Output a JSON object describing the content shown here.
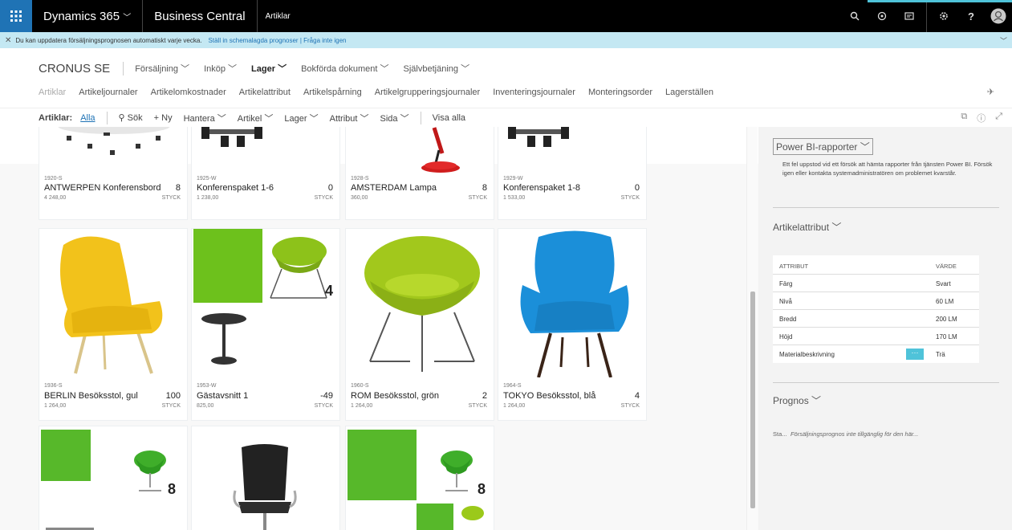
{
  "topbar": {
    "app": "Dynamics 365",
    "product": "Business Central",
    "page": "Artiklar",
    "icons": [
      "search-icon",
      "lightbulb-icon",
      "notes-icon",
      "gear-icon",
      "help-icon",
      "user-avatar"
    ]
  },
  "notification": {
    "text": "Du kan uppdatera försäljningsprognosen automatiskt varje vecka.",
    "link": "Ställ in schemalagda prognoser | Fråga inte igen"
  },
  "role_center": {
    "company": "CRONUS SE",
    "nav": [
      "Försäljning",
      "Inköp",
      "Lager",
      "Bokförda dokument",
      "Självbetjäning"
    ],
    "active_nav": "Lager",
    "subnav": [
      "Artiklar",
      "Artikeljournaler",
      "Artikelomkostnader",
      "Artikelattribut",
      "Artikelspårning",
      "Artikelgrupperingsjournaler",
      "Inventeringsjournaler",
      "Monteringsorder",
      "Lagerställen"
    ]
  },
  "actions": {
    "page_label": "Artiklar:",
    "filter": "Alla",
    "search": "Sök",
    "new": "Ny",
    "menus": [
      "Hantera",
      "Artikel",
      "Lager",
      "Attribut",
      "Sida"
    ],
    "show_all": "Visa alla"
  },
  "items": [
    {
      "code": "1920-S",
      "name": "ANTWERPEN Konferensbord",
      "qty": "8",
      "price": "4 248,00",
      "unit": "STYCK",
      "img": "table"
    },
    {
      "code": "1925-W",
      "name": "Konferenspaket 1-6",
      "qty": "0",
      "price": "1 238,00",
      "unit": "STYCK",
      "img": "conference"
    },
    {
      "code": "1928-S",
      "name": "AMSTERDAM Lampa",
      "qty": "8",
      "price": "360,00",
      "unit": "STYCK",
      "img": "lamp"
    },
    {
      "code": "1929-W",
      "name": "Konferenspaket 1-8",
      "qty": "0",
      "price": "1 533,00",
      "unit": "STYCK",
      "img": "conference"
    },
    {
      "code": "1936-S",
      "name": "BERLIN Besöksstol, gul",
      "qty": "100",
      "price": "1 264,00",
      "unit": "STYCK",
      "img": "yellow-chair"
    },
    {
      "code": "1953-W",
      "name": "Gästavsnitt 1",
      "qty": "-49",
      "price": "825,00",
      "unit": "STYCK",
      "img": "guest-set",
      "badge": "4"
    },
    {
      "code": "1960-S",
      "name": "ROM Besöksstol, grön",
      "qty": "2",
      "price": "1 264,00",
      "unit": "STYCK",
      "img": "green-chair"
    },
    {
      "code": "1964-S",
      "name": "TOKYO Besöksstol, blå",
      "qty": "4",
      "price": "1 264,00",
      "unit": "STYCK",
      "img": "blue-chair"
    },
    {
      "code": "",
      "name": "",
      "qty": "",
      "price": "",
      "unit": "",
      "img": "swan-set",
      "badge": "8"
    },
    {
      "code": "",
      "name": "",
      "qty": "",
      "price": "",
      "unit": "",
      "img": "office-chair"
    },
    {
      "code": "",
      "name": "",
      "qty": "",
      "price": "",
      "unit": "",
      "img": "swan-set2",
      "badge": "8"
    }
  ],
  "factbox": {
    "powerbi_title": "Power BI-rapporter",
    "powerbi_text": "Ett fel uppstod vid ett försök att hämta rapporter från tjänsten Power BI. Försök igen eller kontakta systemadministratören om problemet kvarstår.",
    "attr_title": "Artikelattribut",
    "attr_headers": [
      "ATTRIBUT",
      "VÄRDE"
    ],
    "attributes": [
      {
        "k": "Färg",
        "v": "Svart"
      },
      {
        "k": "Nivå",
        "v": "60 LM"
      },
      {
        "k": "Bredd",
        "v": "200 LM"
      },
      {
        "k": "Höjd",
        "v": "170 LM"
      },
      {
        "k": "Materialbeskrivning",
        "v": "Trä"
      }
    ],
    "prognos_title": "Prognos",
    "prognos_prefix": "Sta...",
    "prognos_text": "Försäljningsprognos inte tillgänglig för den här..."
  },
  "colors": {
    "accent": "#4fc3d9",
    "notif_bg": "#c4e8f3",
    "brand": "#1f73b5",
    "yellow": "#f2c21b",
    "green": "#9bc91a",
    "blue": "#1b8fd9",
    "bright_green": "#57b82a"
  }
}
